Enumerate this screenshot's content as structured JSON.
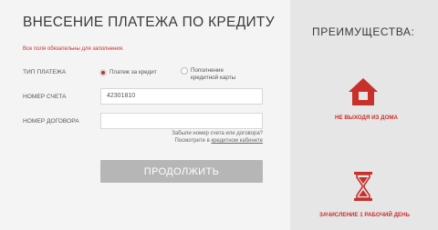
{
  "form": {
    "title": "ВНЕСЕНИЕ ПЛАТЕЖА ПО КРЕДИТУ",
    "required_note": "Все поля обязательны для заполнения.",
    "payment_type_label": "ТИП ПЛАТЕЖА",
    "options": [
      "Платеж за кредит",
      "Пополнение\nкредитной карты"
    ],
    "selected_option": "Платеж за кредит",
    "account_label": "НОМЕР СЧЕТА",
    "account_value": "42301810",
    "contract_label": "НОМЕР ДОГОВОРА",
    "contract_value": "",
    "help_line1": "Забыли номер счета или договора?",
    "help_line2_prefix": "Посмотрите в ",
    "help_line2_link": "кредитном кабинете",
    "continue_label": "ПРОДОЛЖИТЬ"
  },
  "advantages": {
    "title": "ПРЕИМУЩЕСТВА:",
    "items": [
      {
        "icon": "house-icon",
        "label": "НЕ ВЫХОДЯ ИЗ ДОМА"
      },
      {
        "icon": "hourglass-icon",
        "label": "ЗАЧИСЛЕНИЕ 1 РАБОЧИЙ ДЕНЬ"
      }
    ],
    "accent_color": "#c8302c"
  }
}
